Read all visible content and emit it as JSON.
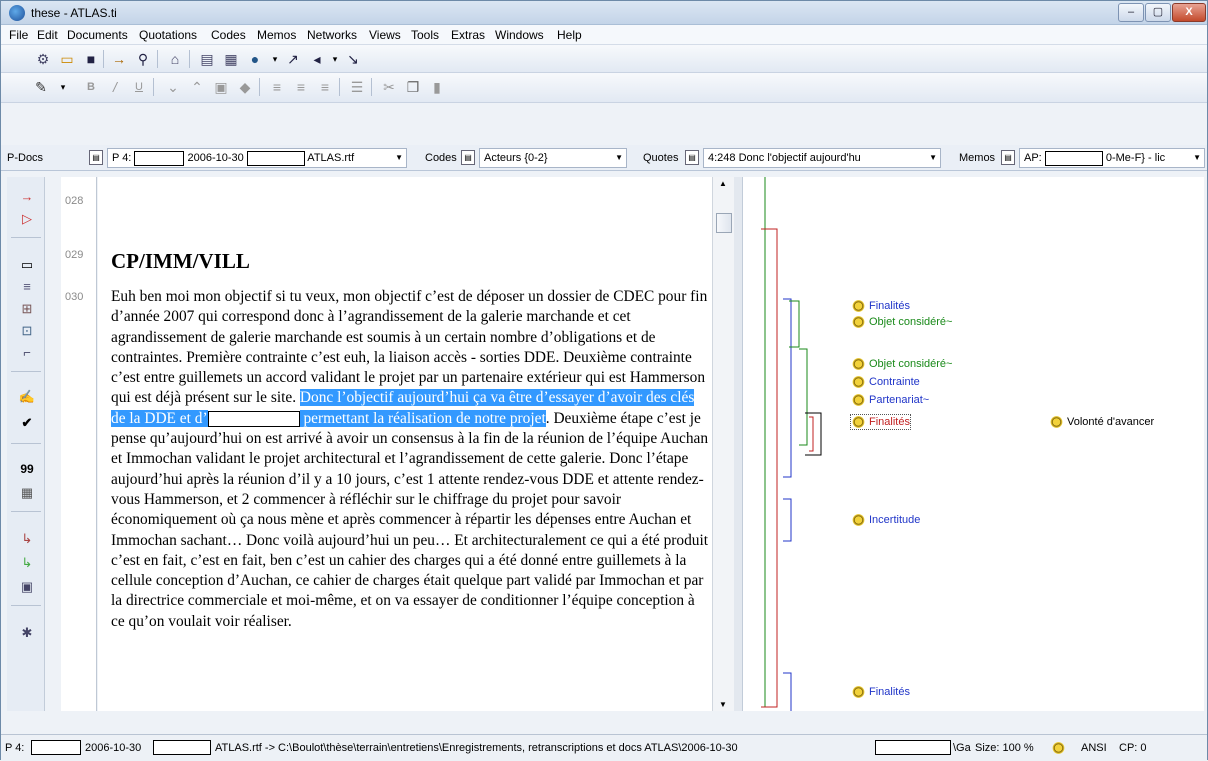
{
  "window": {
    "title": "these - ATLAS.ti"
  },
  "menu": [
    "File",
    "Edit",
    "Documents",
    "Quotations",
    "Codes",
    "Memos",
    "Networks",
    "Views",
    "Tools",
    "Extras",
    "Windows",
    "Help"
  ],
  "docbar": {
    "pdocs_label": "P-Docs",
    "pdoc_prefix": "P 4:",
    "pdoc_date": "2006-10-30",
    "pdoc_suffix": "ATLAS.rtf",
    "codes_label": "Codes",
    "codes_value": "Acteurs {0-2}",
    "quotes_label": "Quotes",
    "quotes_value": "4:248 Donc l'objectif aujourd'hu",
    "memos_label": "Memos",
    "memos_prefix": "AP:",
    "memos_suffix": "0-Me-F} - lic"
  },
  "line_numbers": [
    "028",
    "029",
    "030"
  ],
  "document": {
    "heading": "CP/IMM/VILL",
    "text_before": "Euh ben moi mon objectif si tu veux, mon objectif c’est de déposer un dossier de CDEC pour fin d’année 2007 qui correspond donc à l’agrandissement de la galerie marchande et cet agrandissement de galerie marchande est soumis à un certain nombre d’obligations et de contraintes. Première contrainte c’est euh, la liaison accès - sorties DDE. Deuxième contrainte c’est entre guillemets un accord validant le projet par un partenaire extérieur qui est Hammerson qui est déjà présent sur le site. ",
    "highlight_1": "Donc l’objectif aujourd’hui ça va être d’essayer d’avoir des clés de la DDE et d’",
    "highlight_2": " permettant la réalisation de notre projet",
    "text_after": ". Deuxième étape c’est je pense qu’aujourd’hui on est arrivé à avoir un consensus à la fin de la réunion de l’équipe Auchan et Immochan validant le projet architectural et l’agrandissement de cette galerie. Donc l’étape aujourd’hui après la réunion d’il y a 10 jours, c’est 1 attente rendez-vous DDE et attente rendez-vous Hammerson, et 2 commencer à réfléchir sur le chiffrage du projet pour savoir économiquement où ça nous mène et après commencer à répartir les dépenses entre Auchan et Immochan sachant… Donc voilà aujourd’hui un peu… Et architecturalement ce qui a été produit c’est en fait, c’est en fait, ben c’est un cahier des charges qui a été donné entre guillemets à la cellule conception d’Auchan, ce cahier de charges était quelque part validé par Immochan et par la directrice commerciale et moi-même, et on va essayer de conditionner l’équipe conception à ce qu’on voulait voir réaliser."
  },
  "codes": [
    {
      "label": "Finalités",
      "color": "#2035c8"
    },
    {
      "label": "Objet considéré~",
      "color": "#1a8a1a"
    },
    {
      "label": "Objet considéré~",
      "color": "#1a8a1a"
    },
    {
      "label": "Contrainte",
      "color": "#2035c8"
    },
    {
      "label": "Partenariat~",
      "color": "#2035c8"
    },
    {
      "label": "Finalités",
      "color": "#c02020"
    },
    {
      "label": "Volonté d'avancer",
      "color": "#000000"
    },
    {
      "label": "Incertitude",
      "color": "#2035c8"
    },
    {
      "label": "Finalités",
      "color": "#2035c8"
    }
  ],
  "status": {
    "prefix": "P 4:",
    "date": "2006-10-30",
    "path": "ATLAS.rtf -> C:\\Boulot\\thèse\\terrain\\entretiens\\Enregistrements, retranscriptions et docs ATLAS\\2006-10-30",
    "path_end": "\\Ga",
    "size": "Size: 100 %",
    "encoding": "ANSI",
    "cp": "CP: 0"
  }
}
